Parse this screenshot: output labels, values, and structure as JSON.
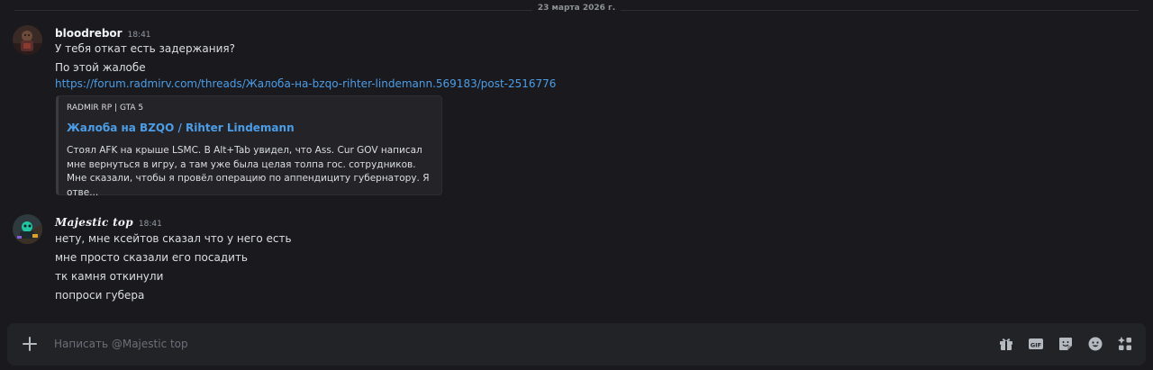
{
  "date_divider": "23 марта 2026 г.",
  "messages": [
    {
      "author": "bloodrebor",
      "time": "18:41",
      "lines": [
        "У тебя откат есть задержания?",
        "По этой жалобе"
      ],
      "link": "https://forum.radmirv.com/threads/Жалоба-на-bzqo-rihter-lindemann.569183/post-2516776",
      "embed": {
        "provider": "RADMIR RP | GTA 5",
        "title": "Жалоба на BZQO / Rihter Lindemann",
        "description": "Стоял AFK на крыше LSMC. В Alt+Tab увидел, что Ass. Cur GOV написал мне вернуться в игру, а там уже была целая толпа гос. сотрудников. Мне сказали, чтобы я провёл операцию по аппендициту губернатору. Я отве..."
      }
    },
    {
      "author": "Majestic top",
      "time": "18:41",
      "lines": [
        "нету, мне ксейтов сказал что у него есть",
        "мне просто сказали его посадить",
        "тк камня откинули",
        "попроси губера"
      ]
    }
  ],
  "composer": {
    "placeholder": "Написать @Majestic top"
  },
  "icons": {
    "attach": "plus-icon",
    "gift": "gift-icon",
    "gif": "gif-icon",
    "sticker": "sticker-icon",
    "emoji": "emoji-icon",
    "apps": "apps-icon"
  },
  "colors": {
    "background": "#1a1a1e",
    "link": "#4c9de8",
    "text": "#dbdee1",
    "muted": "#949ba4"
  }
}
